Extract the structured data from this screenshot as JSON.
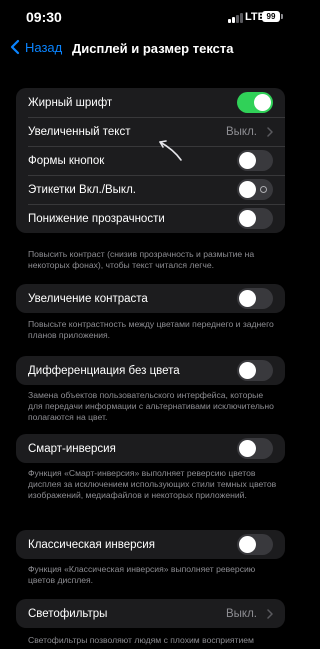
{
  "status_bar": {
    "time": "09:30",
    "network": "LTE",
    "battery": "99",
    "signal_bars_active": 2,
    "signal_bars_total": 4
  },
  "nav": {
    "back_label": "Назад",
    "title": "Дисплей и размер текста",
    "accent_color": "#0a84ff"
  },
  "group1": {
    "rows": [
      {
        "label": "Жирный шрифт",
        "toggle": true
      },
      {
        "label": "Увеличенный текст",
        "value": "Выкл."
      },
      {
        "label": "Формы кнопок",
        "toggle": false
      },
      {
        "label": "Этикетки Вкл./Выкл.",
        "toggle": false
      },
      {
        "label": "Понижение прозрачности",
        "toggle": false
      }
    ],
    "footnote": "Повысить контраст (снизив прозрачность и размытие на некоторых фонах), чтобы текст читался легче."
  },
  "group2": {
    "label": "Увеличение контраста",
    "toggle": false,
    "footnote": "Повысьте контрастность между цветами переднего и заднего планов приложения."
  },
  "group3": {
    "label": "Дифференциация без цвета",
    "toggle": false,
    "footnote": "Замена объектов пользовательского интерфейса, которые для передачи информации с альтернативами исключительно полагаются на цвет."
  },
  "group4": {
    "label": "Смарт-инверсия",
    "toggle": false,
    "footnote": "Функция «Смарт-инверсия» выполняет реверсию цветов дисплея за исключением использующих стили темных цветов изображений, медиафайлов и некоторых приложений."
  },
  "group5": {
    "label": "Классическая инверсия",
    "toggle": false,
    "footnote": "Функция «Классическая инверсия» выполняет реверсию цветов дисплея."
  },
  "group6": {
    "label": "Светофильтры",
    "value": "Выкл.",
    "footnote": "Светофильтры позволяют людям с плохим восприятием цвета лучше различать цвета и другие цвета в"
  },
  "colors": {
    "toggle_on": "#30d158",
    "toggle_off": "#39393d",
    "cell_bg": "#1c1c1e",
    "secondary_text": "#8e8e93"
  }
}
